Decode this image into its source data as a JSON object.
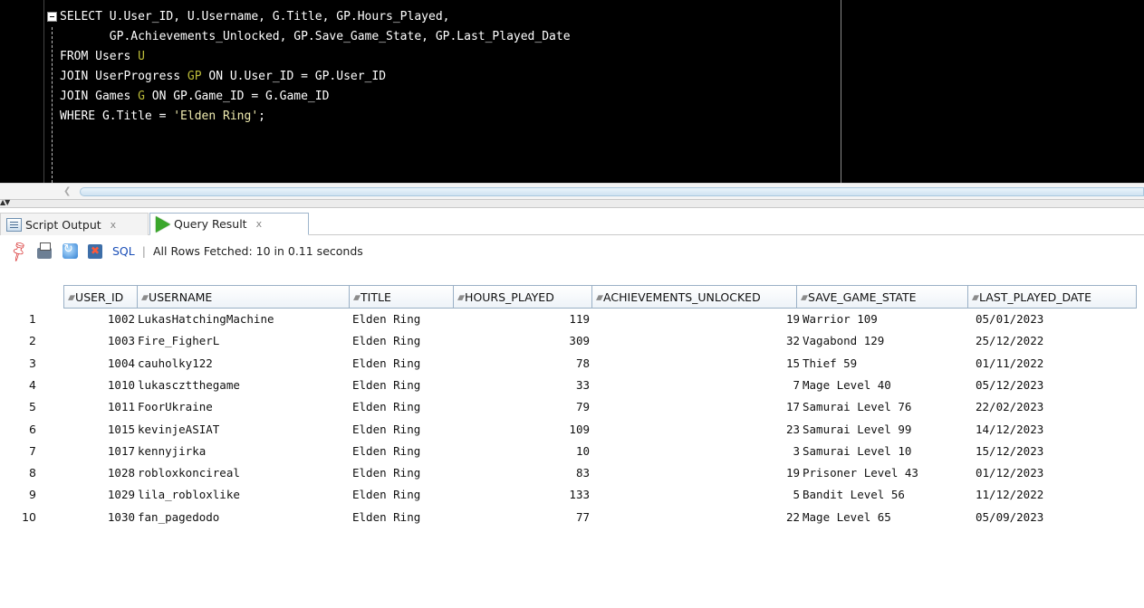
{
  "editor": {
    "query_lines": [
      [
        {
          "t": "SELECT U.User_ID, U.Username, G.Title, GP.Hours_Played,",
          "c": "k"
        }
      ],
      [
        {
          "t": "       GP.Achievements_Unlocked, GP.Save_Game_State, GP.Last_Played_Date",
          "c": "k"
        }
      ],
      [
        {
          "t": "FROM Users ",
          "c": "k"
        },
        {
          "t": "U",
          "c": "alias"
        }
      ],
      [
        {
          "t": "JOIN UserProgress ",
          "c": "k"
        },
        {
          "t": "GP",
          "c": "alias"
        },
        {
          "t": " ON U.User_ID = GP.User_ID",
          "c": "k"
        }
      ],
      [
        {
          "t": "JOIN Games ",
          "c": "k"
        },
        {
          "t": "G",
          "c": "alias"
        },
        {
          "t": " ON GP.Game_ID = G.Game_ID",
          "c": "k"
        }
      ],
      [
        {
          "t": "WHERE G.Title = ",
          "c": "k"
        },
        {
          "t": "'Elden Ring'",
          "c": "str"
        },
        {
          "t": ";",
          "c": "k"
        }
      ]
    ]
  },
  "tabs": {
    "script_output": "Script Output",
    "query_result": "Query Result",
    "close_glyph": "x"
  },
  "toolbar": {
    "sql_label": "SQL",
    "separator": "|",
    "status": "All Rows Fetched: 10 in 0.11 seconds"
  },
  "grid": {
    "columns": [
      "USER_ID",
      "USERNAME",
      "TITLE",
      "HOURS_PLAYED",
      "ACHIEVEMENTS_UNLOCKED",
      "SAVE_GAME_STATE",
      "LAST_PLAYED_DATE"
    ],
    "rows": [
      [
        "1",
        "1002",
        "LukasHatchingMachine",
        "Elden Ring",
        "119",
        "19",
        "Warrior 109",
        "05/01/2023"
      ],
      [
        "2",
        "1003",
        "Fire_FigherL",
        "Elden Ring",
        "309",
        "32",
        "Vagabond 129",
        "25/12/2022"
      ],
      [
        "3",
        "1004",
        "cauholky122",
        "Elden Ring",
        "78",
        "15",
        "Thief 59",
        "01/11/2022"
      ],
      [
        "4",
        "1010",
        "lukascztthegame",
        "Elden Ring",
        "33",
        "7",
        "Mage Level 40",
        "05/12/2023"
      ],
      [
        "5",
        "1011",
        "FoorUkraine",
        "Elden Ring",
        "79",
        "17",
        "Samurai Level 76",
        "22/02/2023"
      ],
      [
        "6",
        "1015",
        "kevinjeASIAT",
        "Elden Ring",
        "109",
        "23",
        "Samurai Level 99",
        "14/12/2023"
      ],
      [
        "7",
        "1017",
        "kennyjirka",
        "Elden Ring",
        "10",
        "3",
        "Samurai Level 10",
        "15/12/2023"
      ],
      [
        "8",
        "1028",
        "robloxkoncireal",
        "Elden Ring",
        "83",
        "19",
        "Prisoner Level 43",
        "01/12/2023"
      ],
      [
        "9",
        "1029",
        "lila_robloxlike",
        "Elden Ring",
        "133",
        "5",
        "Bandit Level 56",
        "11/12/2022"
      ],
      [
        "10",
        "1030",
        "fan_pagedodo",
        "Elden Ring",
        "77",
        "22",
        "Mage Level 65",
        "05/09/2023"
      ]
    ]
  }
}
